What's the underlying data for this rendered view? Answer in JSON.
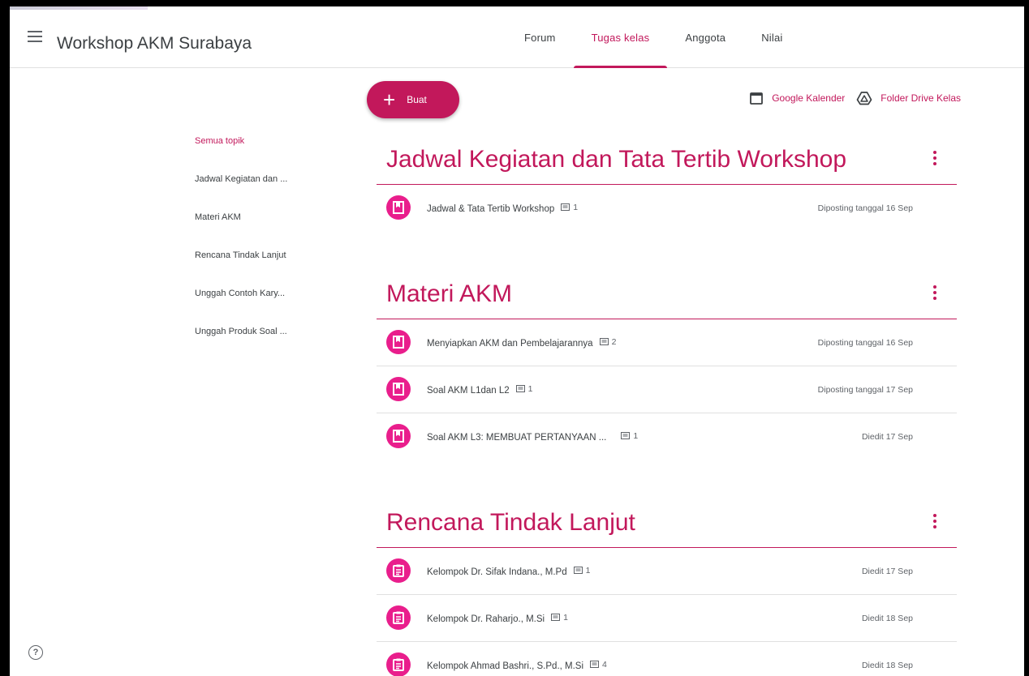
{
  "header": {
    "class_title": "Workshop AKM Surabaya"
  },
  "tabs": [
    {
      "label": "Forum",
      "active": false
    },
    {
      "label": "Tugas kelas",
      "active": true
    },
    {
      "label": "Anggota",
      "active": false
    },
    {
      "label": "Nilai",
      "active": false
    }
  ],
  "create_button": {
    "label": "Buat",
    "icon": "plus-icon"
  },
  "links": {
    "calendar": "Google Kalender",
    "drive": "Folder Drive Kelas"
  },
  "sidebar": {
    "items": [
      "Semua topik",
      "Jadwal Kegiatan dan ...",
      "Materi AKM",
      "Rencana Tindak Lanjut",
      "Unggah Contoh Kary...",
      "Unggah Produk Soal ..."
    ]
  },
  "topics": [
    {
      "title": "Jadwal Kegiatan dan Tata Tertib Workshop",
      "items": [
        {
          "title": "Jadwal & Tata Tertib Workshop",
          "comments": "1",
          "date": "Diposting tanggal 16 Sep",
          "icon": "material-icon"
        }
      ]
    },
    {
      "title": "Materi AKM",
      "items": [
        {
          "title": "Menyiapkan AKM dan Pembelajarannya",
          "comments": "2",
          "date": "Diposting tanggal 16 Sep",
          "icon": "material-icon"
        },
        {
          "title": "Soal AKM L1dan L2",
          "comments": "1",
          "date": "Diposting tanggal 17 Sep",
          "icon": "material-icon"
        },
        {
          "title": "Soal AKM L3: MEMBUAT PERTANYAAN ...",
          "comments": "1",
          "date": "Diedit 17 Sep",
          "icon": "material-icon"
        }
      ]
    },
    {
      "title": "Rencana Tindak Lanjut",
      "items": [
        {
          "title": "Kelompok Dr. Sifak Indana., M.Pd",
          "comments": "1",
          "date": "Diedit 17 Sep",
          "icon": "assignment-icon"
        },
        {
          "title": "Kelompok Dr. Raharjo., M.Si",
          "comments": "1",
          "date": "Diedit 18 Sep",
          "icon": "assignment-icon"
        },
        {
          "title": "Kelompok Ahmad Bashri., S.Pd., M.Si",
          "comments": "4",
          "date": "Diedit 18 Sep",
          "icon": "assignment-icon"
        }
      ]
    }
  ],
  "colors": {
    "accent": "#c2185b",
    "icon_bg": "#e91e8c"
  }
}
